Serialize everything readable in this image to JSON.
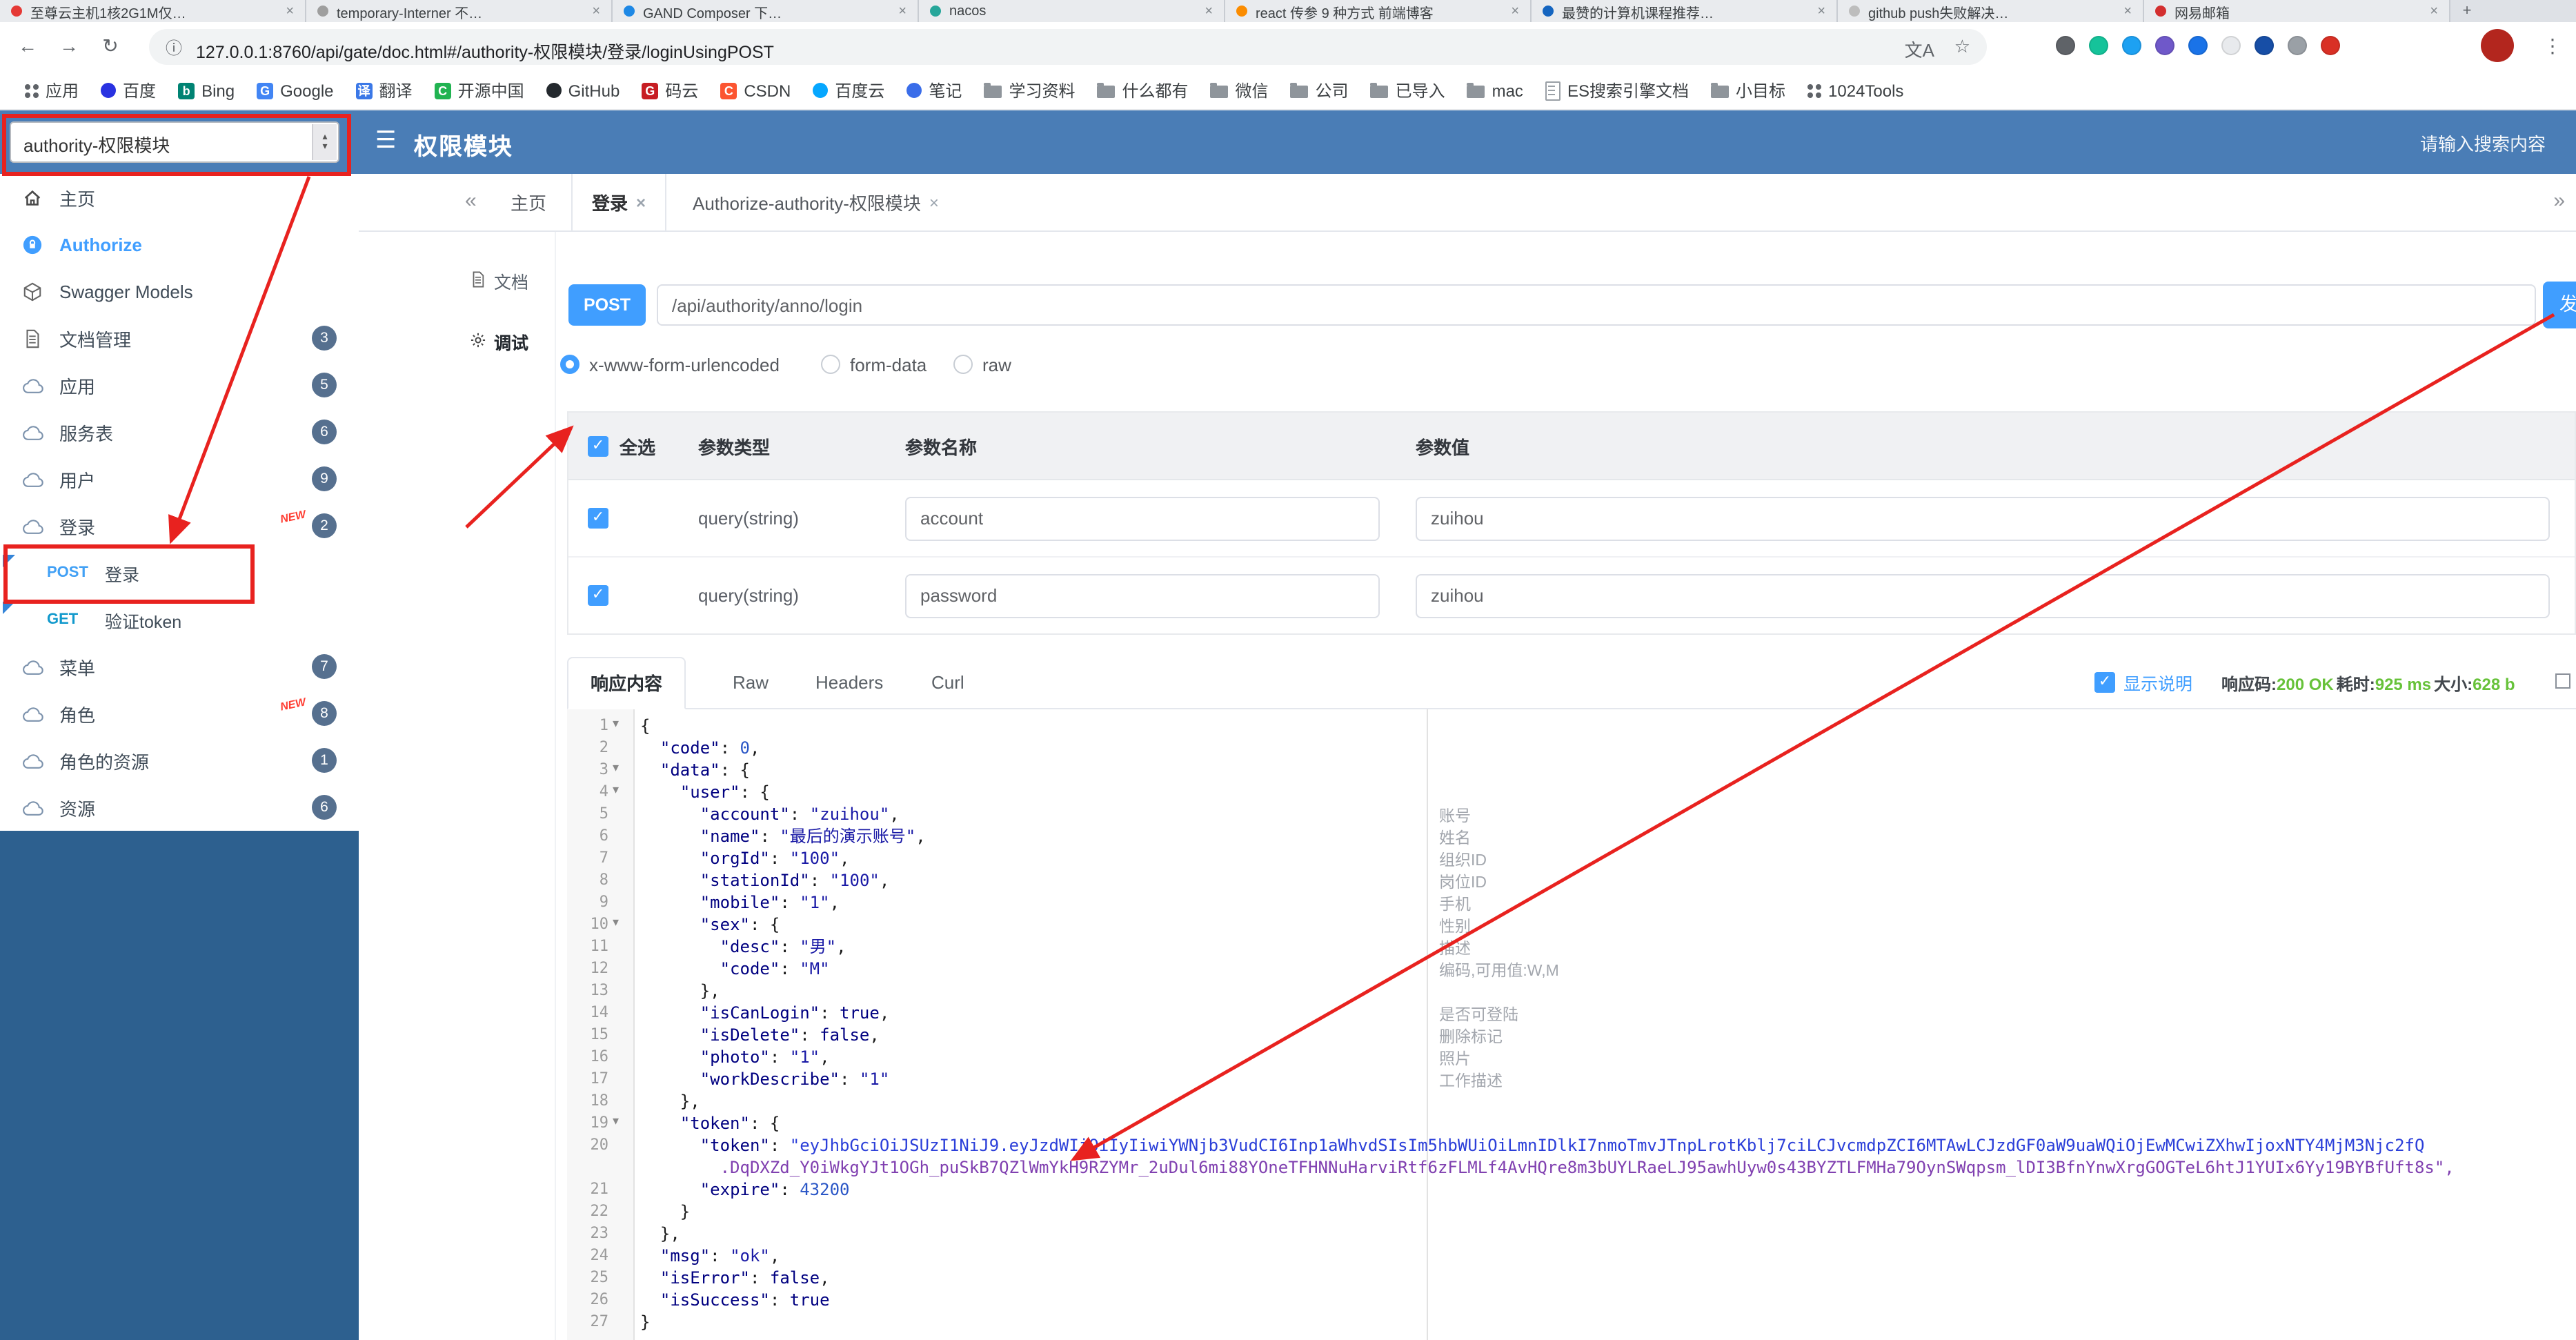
{
  "icons": {
    "close": "×",
    "back": "←",
    "forward": "→",
    "reload": "↻",
    "info": "ⓘ",
    "star": "☆",
    "kebab": "⋮",
    "menu": "☰",
    "scroll_left": "«",
    "scroll_right": "»",
    "select_up": "▴",
    "select_down": "▾",
    "translate": "文A",
    "checkmark": "✓",
    "fold": "▾",
    "plus": "+"
  },
  "annotations": {
    "color": "#e8221f"
  },
  "browser": {
    "url": "127.0.0.1:8760/api/gate/doc.html#/authority-权限模块/登录/loginUsingPOST",
    "avatar_color": "#b3261e",
    "tabs": [
      {
        "title": "至尊云主机1核2G1M仅…",
        "color": "#e53935"
      },
      {
        "title": "temporary-Interner 不…",
        "color": "#9e9e9e"
      },
      {
        "title": "GAND Composer 下…",
        "color": "#1e88e5"
      },
      {
        "title": "nacos",
        "color": "#26a69a"
      },
      {
        "title": "react 传参 9 种方式 前端博客",
        "color": "#fb8c00"
      },
      {
        "title": "最赞的计算机课程推荐…",
        "color": "#1565c0"
      },
      {
        "title": "github push失败解决…",
        "color": "#bdbdbd"
      },
      {
        "title": "网易邮箱",
        "color": "#d32f2f"
      }
    ],
    "ext_colors": [
      "#5f6368",
      "#15c39a",
      "#1da1f2",
      "#6f58c9",
      "#1a73e8",
      "#e8eaed",
      "#174ea6",
      "#9aa0a6",
      "#d93025"
    ],
    "bookmarks": [
      {
        "label": "应用",
        "icon": "apps"
      },
      {
        "label": "百度",
        "icon": "dot",
        "color": "#2932e1"
      },
      {
        "label": "Bing",
        "icon": "letter",
        "letter": "b",
        "color": "#008373"
      },
      {
        "label": "Google",
        "icon": "letter",
        "letter": "G",
        "color": "#4285f4"
      },
      {
        "label": "翻译",
        "icon": "letter",
        "letter": "译",
        "color": "#3b78e7"
      },
      {
        "label": "开源中国",
        "icon": "letter",
        "letter": "C",
        "color": "#21b351"
      },
      {
        "label": "GitHub",
        "icon": "dot",
        "color": "#24292e"
      },
      {
        "label": "码云",
        "icon": "letter",
        "letter": "G",
        "color": "#c71d23"
      },
      {
        "label": "CSDN",
        "icon": "letter",
        "letter": "C",
        "color": "#fc5531"
      },
      {
        "label": "百度云",
        "icon": "dot",
        "color": "#06a7ff"
      },
      {
        "label": "笔记",
        "icon": "dot",
        "color": "#3a6de9"
      },
      {
        "label": "学习资料",
        "icon": "folder"
      },
      {
        "label": "什么都有",
        "icon": "folder"
      },
      {
        "label": "微信",
        "icon": "folder"
      },
      {
        "label": "公司",
        "icon": "folder"
      },
      {
        "label": "已导入",
        "icon": "folder"
      },
      {
        "label": "mac",
        "icon": "folder"
      },
      {
        "label": "ES搜索引擎文档",
        "icon": "doc"
      },
      {
        "label": "小目标",
        "icon": "folder"
      },
      {
        "label": "1024Tools",
        "icon": "apps"
      }
    ]
  },
  "page_header": {
    "group_select_value": "authority-权限模块",
    "title": "权限模块",
    "search_placeholder": "请输入搜索内容"
  },
  "sidebar": {
    "rows": [
      {
        "kind": "item",
        "icon": "home",
        "label": "主页"
      },
      {
        "kind": "item",
        "icon": "auth",
        "label": "Authorize",
        "accent": true
      },
      {
        "kind": "item",
        "icon": "models",
        "label": "Swagger Models"
      },
      {
        "kind": "item",
        "icon": "doc",
        "label": "文档管理",
        "badge": "3"
      },
      {
        "kind": "item",
        "icon": "cloud",
        "label": "应用",
        "badge": "5"
      },
      {
        "kind": "item",
        "icon": "cloud",
        "label": "服务表",
        "badge": "6"
      },
      {
        "kind": "item",
        "icon": "cloud",
        "label": "用户",
        "badge": "9"
      },
      {
        "kind": "item",
        "icon": "cloud",
        "label": "登录",
        "badge": "2",
        "isNew": true
      },
      {
        "kind": "sub",
        "method": "POST",
        "label": "登录",
        "flag": true
      },
      {
        "kind": "sub",
        "method": "GET",
        "label": "验证token",
        "flag": true
      },
      {
        "kind": "item",
        "icon": "cloud",
        "label": "菜单",
        "badge": "7"
      },
      {
        "kind": "item",
        "icon": "cloud",
        "label": "角色",
        "badge": "8",
        "isNew": true
      },
      {
        "kind": "item",
        "icon": "cloud",
        "label": "角色的资源",
        "badge": "1"
      },
      {
        "kind": "item",
        "icon": "cloud",
        "label": "资源",
        "badge": "6"
      }
    ]
  },
  "doc_tabs": {
    "tabs": [
      {
        "label": "主页",
        "closable": false,
        "active": false
      },
      {
        "label": "登录",
        "closable": true,
        "active": true
      },
      {
        "label": "Authorize-authority-权限模块",
        "closable": true,
        "active": false
      }
    ]
  },
  "view_tabs": {
    "items": [
      {
        "label": "文档",
        "active": false
      },
      {
        "label": "调试",
        "active": true
      }
    ]
  },
  "request": {
    "method": "POST",
    "path": "/api/authority/anno/login",
    "send_label": "发送",
    "content_types": [
      {
        "label": "x-www-form-urlencoded",
        "selected": true
      },
      {
        "label": "form-data",
        "selected": false
      },
      {
        "label": "raw",
        "selected": false
      }
    ]
  },
  "params_table": {
    "select_all_label": "全选",
    "col_type": "参数类型",
    "col_name": "参数名称",
    "col_value": "参数值",
    "rows": [
      {
        "checked": true,
        "type": "query(string)",
        "name": "account",
        "value": "zuihou"
      },
      {
        "checked": true,
        "type": "query(string)",
        "name": "password",
        "value": "zuihou"
      }
    ]
  },
  "response": {
    "tabs": [
      {
        "label": "响应内容",
        "active": true
      },
      {
        "label": "Raw",
        "active": false
      },
      {
        "label": "Headers",
        "active": false
      },
      {
        "label": "Curl",
        "active": false
      }
    ],
    "show_desc": {
      "checked": true,
      "label": "显示说明"
    },
    "status": {
      "code_label": "响应码:",
      "code": "200 OK",
      "time_label": "耗时:",
      "time": "925 ms",
      "size_label": "大小:",
      "size": "628 b"
    },
    "code": {
      "rows": [
        {
          "n": "1",
          "text": "{"
        },
        {
          "n": "2",
          "text": "  \"code\": 0,"
        },
        {
          "n": "3",
          "text": "  \"data\": {"
        },
        {
          "n": "4",
          "text": "    \"user\": {"
        },
        {
          "n": "5",
          "text": "      \"account\": \"zuihou\",",
          "note": "账号"
        },
        {
          "n": "6",
          "text": "      \"name\": \"最后的演示账号\",",
          "note": "姓名"
        },
        {
          "n": "7",
          "text": "      \"orgId\": \"100\",",
          "note": "组织ID"
        },
        {
          "n": "8",
          "text": "      \"stationId\": \"100\",",
          "note": "岗位ID"
        },
        {
          "n": "9",
          "text": "      \"mobile\": \"1\",",
          "note": "手机"
        },
        {
          "n": "10",
          "text": "      \"sex\": {",
          "note": "性别"
        },
        {
          "n": "11",
          "text": "        \"desc\": \"男\",",
          "note": "描述"
        },
        {
          "n": "12",
          "text": "        \"code\": \"M\"",
          "note": "编码,可用值:W,M"
        },
        {
          "n": "13",
          "text": "      },"
        },
        {
          "n": "14",
          "text": "      \"isCanLogin\": true,",
          "note": "是否可登陆"
        },
        {
          "n": "15",
          "text": "      \"isDelete\": false,",
          "note": "删除标记"
        },
        {
          "n": "16",
          "text": "      \"photo\": \"1\",",
          "note": "照片"
        },
        {
          "n": "17",
          "text": "      \"workDescribe\": \"1\"",
          "note": "工作描述"
        },
        {
          "n": "18",
          "text": "    },"
        },
        {
          "n": "19",
          "text": "    \"token\": {"
        },
        {
          "n": "20",
          "spans": [
            [
              "      ",
              ""
            ],
            [
              "\"token\"",
              "tk"
            ],
            [
              ": ",
              ""
            ],
            [
              "\"eyJhbGciOiJSUzI1NiJ9.eyJzdWIiOiIyIiwiYWNjb3VudCI6Inp1aWhvdSIsIm5hbWUiOiLmnIDlkI7nmoTmvJTnpLrotKblj7ciLCJvcmdpZCI6MTAwLCJzdGF0aW9uaWQiOjEwMCwiZXhwIjoxNTY4MjM3Njc2fQ",
              "tt"
            ]
          ]
        },
        {
          "n": "",
          "spans": [
            [
              "        .DqDXZd_Y0iWkgYJt1OGh_puSkB7QZlWmYkH9RZYMr_2uDul6mi88YOneTFHNNuHarviRtf6zFLMLf4AvHQre8m3bUYLRaeLJ95awhUyw0s43BYZTLFMHa79OynSWqpsm_lDI3BfnYnwXrgGOGTeL6htJ1YUIx6Yy19BYBfUft8s\",",
              "tp"
            ]
          ]
        },
        {
          "n": "21",
          "text": "      \"expire\": 43200"
        },
        {
          "n": "22",
          "text": "    }"
        },
        {
          "n": "23",
          "text": "  },"
        },
        {
          "n": "24",
          "text": "  \"msg\": \"ok\","
        },
        {
          "n": "25",
          "text": "  \"isError\": false,"
        },
        {
          "n": "26",
          "text": "  \"isSuccess\": true"
        },
        {
          "n": "27",
          "text": "}"
        }
      ]
    }
  }
}
